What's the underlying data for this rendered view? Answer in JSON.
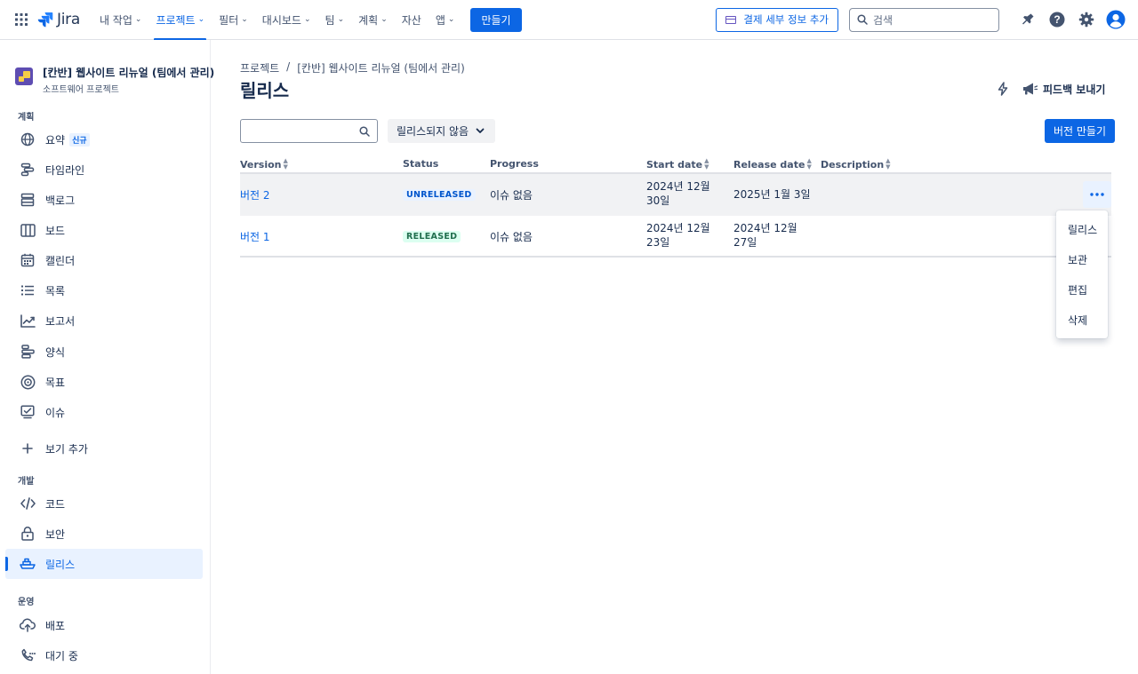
{
  "topnav": {
    "logo": "Jira",
    "items": [
      {
        "label": "내 작업",
        "chevron": true
      },
      {
        "label": "프로젝트",
        "chevron": true,
        "active": true
      },
      {
        "label": "필터",
        "chevron": true
      },
      {
        "label": "대시보드",
        "chevron": true
      },
      {
        "label": "팀",
        "chevron": true
      },
      {
        "label": "계획",
        "chevron": true
      },
      {
        "label": "자산",
        "chevron": false
      },
      {
        "label": "앱",
        "chevron": true
      }
    ],
    "create_label": "만들기",
    "billing_label": "결제 세부 정보 추가",
    "search_placeholder": "검색"
  },
  "sidebar": {
    "project_name": "[칸반] 웹사이트 리뉴얼 (팀에서 관리)",
    "project_type": "소프트웨어 프로젝트",
    "sections": {
      "plan": "계획",
      "dev": "개발",
      "ops": "운영"
    },
    "plan_items": [
      {
        "label": "요약",
        "icon": "globe-icon",
        "badge": "신규"
      },
      {
        "label": "타임라인",
        "icon": "timeline-icon"
      },
      {
        "label": "백로그",
        "icon": "backlog-icon"
      },
      {
        "label": "보드",
        "icon": "board-icon"
      },
      {
        "label": "캘린더",
        "icon": "calendar-icon"
      },
      {
        "label": "목록",
        "icon": "list-icon"
      },
      {
        "label": "보고서",
        "icon": "chart-icon"
      },
      {
        "label": "양식",
        "icon": "form-icon"
      },
      {
        "label": "목표",
        "icon": "target-icon"
      },
      {
        "label": "이슈",
        "icon": "issues-icon"
      }
    ],
    "add_view": "보기 추가",
    "dev_items": [
      {
        "label": "코드",
        "icon": "code-icon"
      },
      {
        "label": "보안",
        "icon": "lock-icon"
      },
      {
        "label": "릴리스",
        "icon": "ship-icon",
        "active": true
      }
    ],
    "ops_items": [
      {
        "label": "배포",
        "icon": "cloud-upload-icon"
      },
      {
        "label": "대기 중",
        "icon": "on-call-icon"
      }
    ]
  },
  "main": {
    "breadcrumb": [
      "프로젝트",
      "[칸반] 웹사이트 리뉴얼 (팀에서 관리)"
    ],
    "title": "릴리스",
    "feedback_label": "피드백 보내기",
    "status_filter": "릴리스되지 않음",
    "create_version_label": "버전 만들기",
    "table": {
      "headers": [
        "Version",
        "Status",
        "Progress",
        "Start date",
        "Release date",
        "Description"
      ],
      "rows": [
        {
          "version": "버전 2",
          "status": "UNRELEASED",
          "progress": "이슈 없음",
          "start": "2024년 12월 30일",
          "release": "2025년 1월 3일",
          "description": ""
        },
        {
          "version": "버전 1",
          "status": "RELEASED",
          "progress": "이슈 없음",
          "start": "2024년 12월 23일",
          "release": "2024년 12월 27일",
          "description": ""
        }
      ]
    },
    "row_menu": [
      "릴리스",
      "보관",
      "편집",
      "삭제"
    ]
  }
}
